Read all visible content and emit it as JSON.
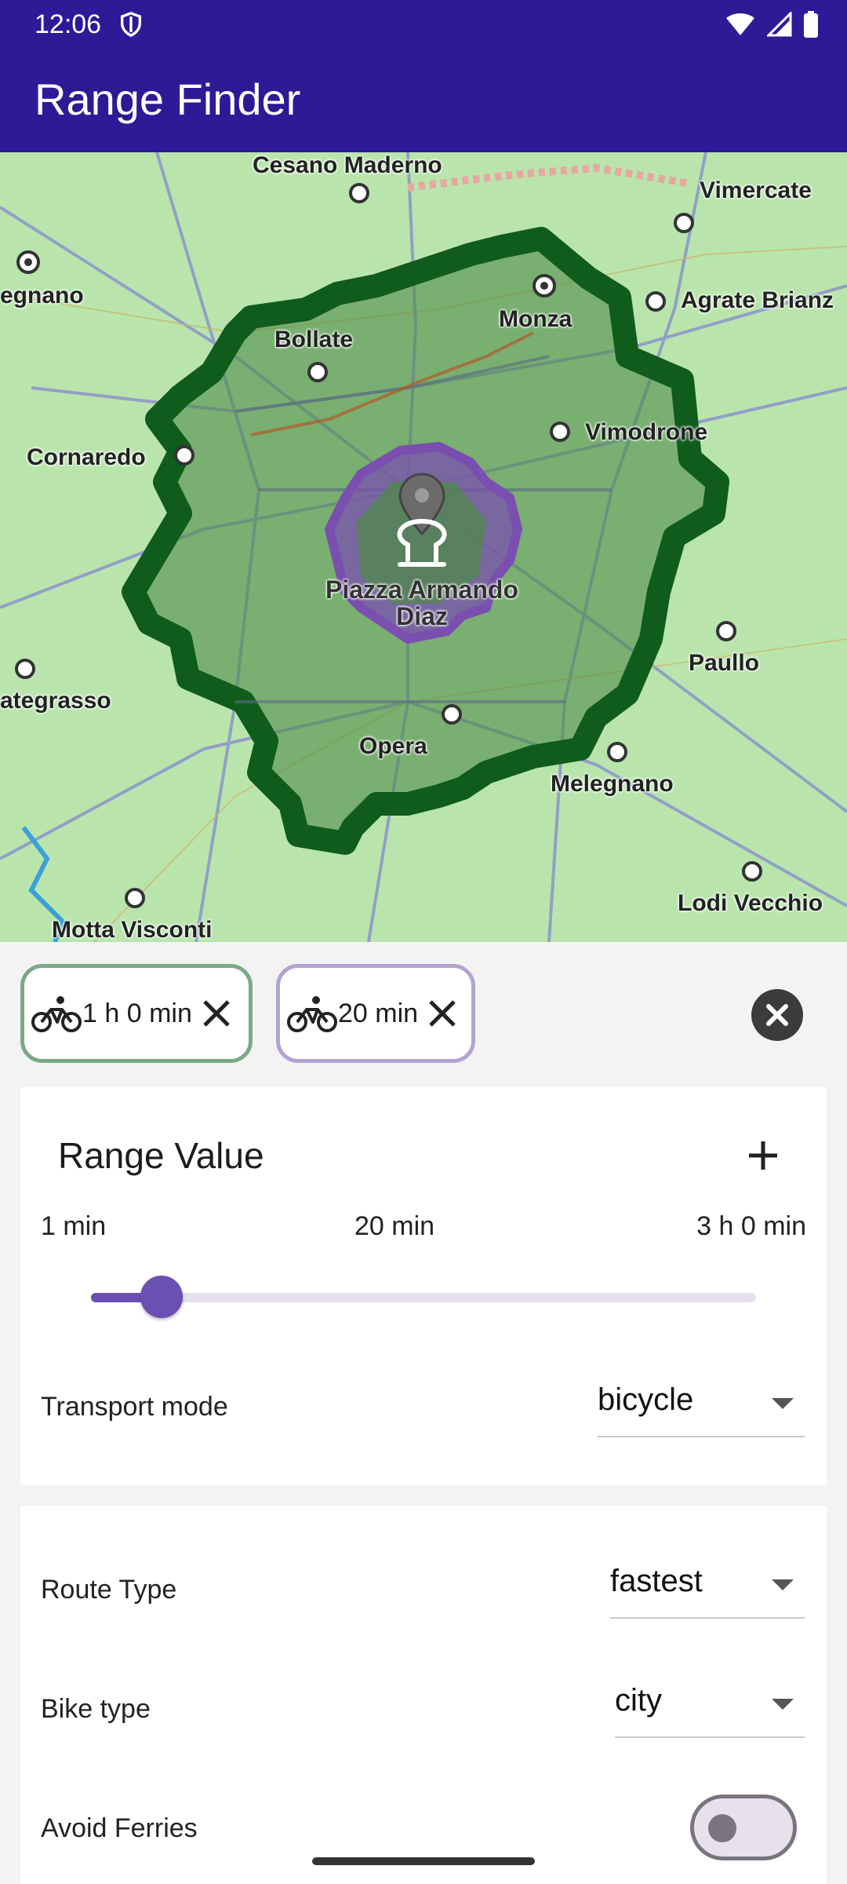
{
  "status": {
    "time": "12:06"
  },
  "app": {
    "title": "Range Finder"
  },
  "map": {
    "places": [
      "Cesano Maderno",
      "Vimercate",
      "egnano",
      "Agrate Brianz",
      "Monza",
      "Bollate",
      "Vimodrone",
      "Cornaredo",
      "Paullo",
      "ategrasso",
      "Opera",
      "Melegnano",
      "Lodi Vecchio",
      "Motta Visconti"
    ],
    "center_label_line1": "Piazza Armando",
    "center_label_line2": "Diaz",
    "colors": {
      "outer_range": "#0f5c1c",
      "inner_range": "#7a4fb0",
      "land": "#b9e5ad"
    }
  },
  "ranges": {
    "chips": [
      {
        "icon": "bicycle-icon",
        "label": "1 h 0 min",
        "border": "#7ba988"
      },
      {
        "icon": "bicycle-icon",
        "label": "20 min",
        "border": "#b3a2d1"
      }
    ]
  },
  "range_card": {
    "title": "Range Value",
    "tick_min": "1 min",
    "tick_current": "20 min",
    "tick_max": "3 h 0 min",
    "slider_fraction": 0.106,
    "transport_label": "Transport mode",
    "transport_value": "bicycle"
  },
  "options_card": {
    "route_type_label": "Route Type",
    "route_type_value": "fastest",
    "bike_type_label": "Bike type",
    "bike_type_value": "city",
    "avoid_ferries_label": "Avoid Ferries",
    "avoid_ferries_on": false
  }
}
